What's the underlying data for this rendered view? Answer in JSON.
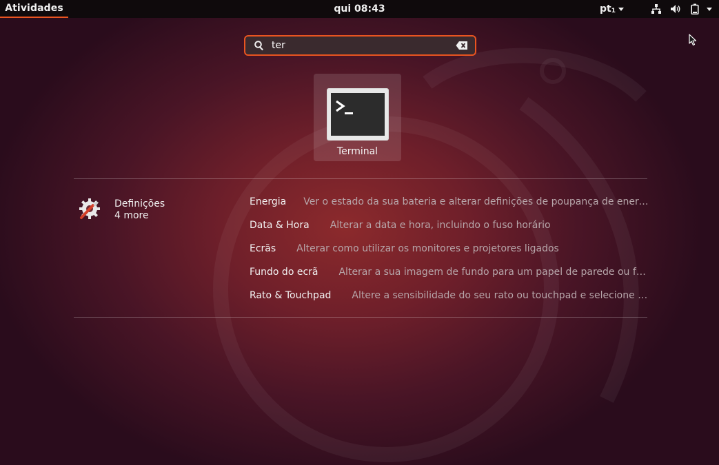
{
  "topbar": {
    "activities_label": "Atividades",
    "clock": "qui 08:43",
    "language": "pt",
    "language_sub": "1",
    "accent": "#e95420",
    "icons": [
      "network-icon",
      "volume-icon",
      "battery-icon",
      "system-menu-arrow-icon"
    ]
  },
  "search": {
    "value": "ter",
    "icon": "search-icon",
    "clear_icon": "clear-text-icon"
  },
  "app_result": {
    "label": "Terminal",
    "icon": "terminal-icon"
  },
  "provider": {
    "name": "Definições",
    "more": "4 more",
    "icon": "settings-icon"
  },
  "results": [
    {
      "name": "Energia",
      "description": "Ver o estado da sua bateria e alterar definições de poupança de energia"
    },
    {
      "name": "Data & Hora",
      "description": "Alterar a data e hora, incluindo o fuso horário"
    },
    {
      "name": "Ecrãs",
      "description": "Alterar como utilizar os monitores e projetores ligados"
    },
    {
      "name": "Fundo do ecrã",
      "description": "Alterar a sua imagem de fundo para um papel de parede ou foto…"
    },
    {
      "name": "Rato & Touchpad",
      "description": "Altere a sensibilidade do seu rato ou touchpad e selecione de…"
    }
  ]
}
